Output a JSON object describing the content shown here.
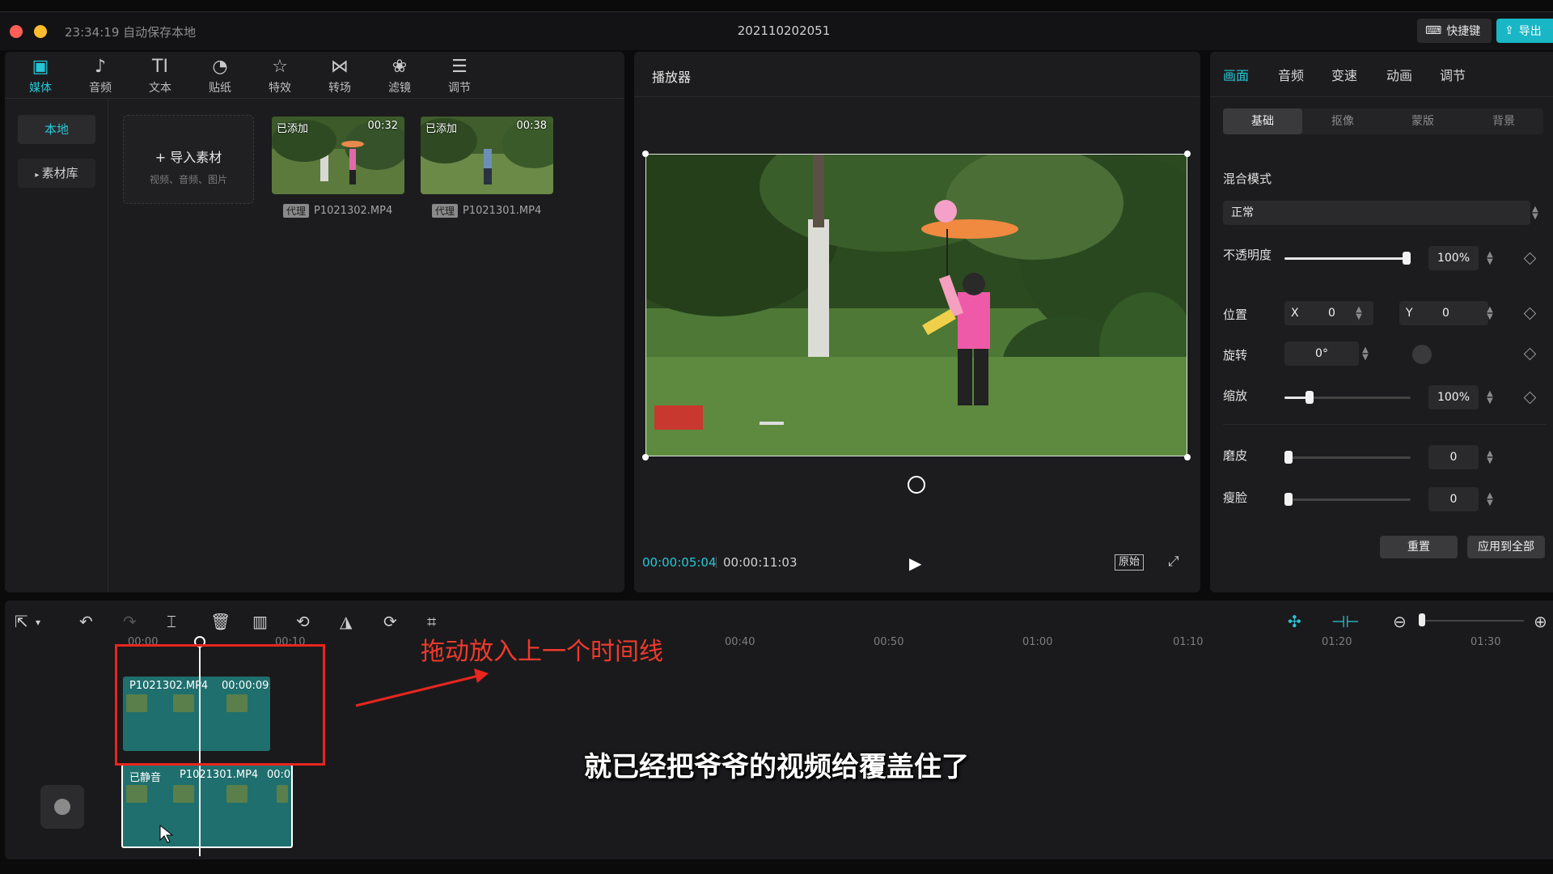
{
  "titlebar": {
    "autosave": "23:34:19 自动保存本地",
    "title": "202110202051",
    "shortcut_label": "快捷键",
    "export_label": "导出"
  },
  "media_toolbar": [
    {
      "label": "媒体",
      "icon": "media-icon",
      "active": true
    },
    {
      "label": "音频",
      "icon": "audio-icon"
    },
    {
      "label": "文本",
      "icon": "text-icon"
    },
    {
      "label": "贴纸",
      "icon": "sticker-icon"
    },
    {
      "label": "特效",
      "icon": "effects-icon"
    },
    {
      "label": "转场",
      "icon": "transition-icon"
    },
    {
      "label": "滤镜",
      "icon": "filter-icon"
    },
    {
      "label": "调节",
      "icon": "adjust-icon"
    }
  ],
  "media_side": {
    "local": "本地",
    "library": "素材库"
  },
  "import": {
    "title": "导入素材",
    "subtitle": "视频、音频、图片"
  },
  "media_items": [
    {
      "added": "已添加",
      "duration": "00:32",
      "proxy": "代理",
      "name": "P1021302.MP4"
    },
    {
      "added": "已添加",
      "duration": "00:38",
      "proxy": "代理",
      "name": "P1021301.MP4"
    }
  ],
  "player": {
    "title": "播放器",
    "current_time": "00:00:05:04",
    "total_time": "00:00:11:03",
    "orig_label": "原始"
  },
  "props": {
    "tabs": [
      "画面",
      "音频",
      "变速",
      "动画",
      "调节"
    ],
    "sub_tabs": [
      "基础",
      "抠像",
      "蒙版",
      "背景"
    ],
    "blend_label": "混合模式",
    "blend_value": "正常",
    "opacity_label": "不透明度",
    "opacity_value": "100%",
    "opacity_level": 1.0,
    "position_label": "位置",
    "pos_x_label": "X",
    "pos_x": "0",
    "pos_y_label": "Y",
    "pos_y": "0",
    "rotation_label": "旋转",
    "rotation_value": "0°",
    "scale_label": "缩放",
    "scale_value": "100%",
    "smooth_label": "磨皮",
    "smooth_value": "0",
    "slim_label": "瘦脸",
    "slim_value": "0",
    "reset_label": "重置",
    "apply_all_label": "应用到全部"
  },
  "timeline": {
    "ruler": [
      "00:00",
      "00:10",
      "00:40",
      "00:50",
      "01:00",
      "01:10",
      "01:20",
      "01:30"
    ],
    "clip_top": {
      "name": "P1021302.MP4",
      "duration": "00:00:09:"
    },
    "clip_bottom": {
      "muted": "已静音",
      "name": "P1021301.MP4",
      "duration": "00:0"
    },
    "annotation": "拖动放入上一个时间线",
    "subtitle": "就已经把爷爷的视频给覆盖住了"
  },
  "colors": {
    "accent": "#27c7d6",
    "annotation": "#e8251f"
  }
}
